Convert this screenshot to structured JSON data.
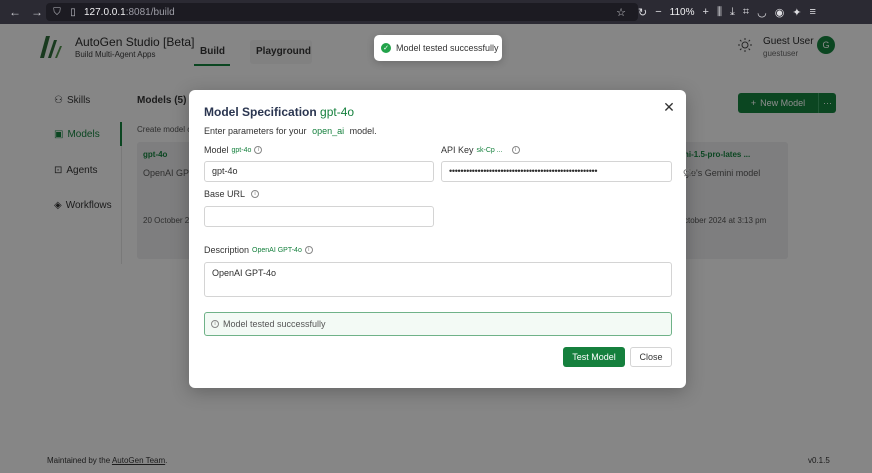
{
  "browser": {
    "url_host": "127.0.0.1",
    "url_rest": ":8081/build",
    "zoom": "110%"
  },
  "app": {
    "title": "AutoGen Studio [Beta]",
    "subtitle": "Build Multi-Agent Apps",
    "tabs": [
      {
        "label": "Build"
      },
      {
        "label": "Playground"
      }
    ],
    "user": {
      "name": "Guest User",
      "id": "guestuser",
      "initial": "G"
    }
  },
  "sidebar": {
    "items": [
      {
        "label": "Skills"
      },
      {
        "label": "Models"
      },
      {
        "label": "Agents"
      },
      {
        "label": "Workflows"
      }
    ]
  },
  "models_page": {
    "title": "Models (5)",
    "description": "Create model co",
    "new_model_label": "New Model",
    "cards": [
      {
        "name": "gpt-4o",
        "text": "OpenAI GPT",
        "date": "20 October 2"
      },
      {
        "name": "ni-1.5-pro-lates ...",
        "text": "gle's Gemini model",
        "date": "ctober 2024 at 3:13 pm"
      }
    ]
  },
  "footer": {
    "prefix": "Maintained by the ",
    "link": "AutoGen Team",
    "suffix": ".",
    "version": "v0.1.5"
  },
  "modal": {
    "title": "Model Specification",
    "title_accent": "gpt-4o",
    "intro_prefix": "Enter parameters for your",
    "intro_code": "open_ai",
    "intro_suffix": "model.",
    "model_label": "Model",
    "model_sub": "gpt-4o",
    "model_value": "gpt-4o",
    "api_key_label": "API Key",
    "api_key_sub": "sk-Cp ...",
    "api_key_value": "••••••••••••••••••••••••••••••••••••••••••••••••••••",
    "base_url_label": "Base URL",
    "base_url_value": "",
    "description_label": "Description",
    "description_sub": "OpenAI GPT-4o",
    "description_value": "OpenAI GPT-4o",
    "status_text": "Model tested successfully",
    "test_button": "Test Model",
    "close_button": "Close"
  },
  "toast": {
    "message": "Model tested successfully"
  },
  "colors": {
    "accent": "#15803d",
    "overlay": "rgba(0,0,0,0.45)"
  }
}
